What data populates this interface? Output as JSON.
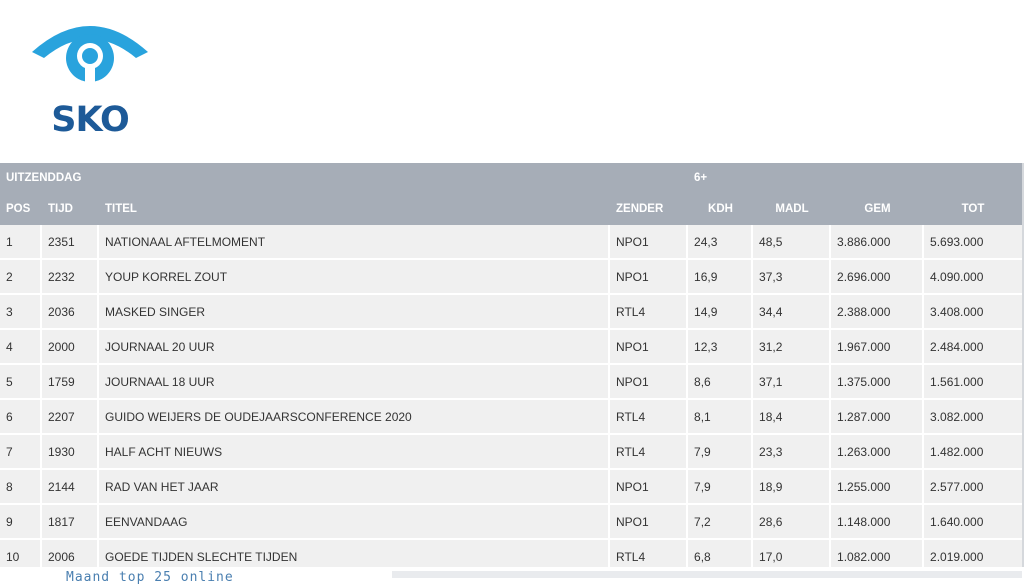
{
  "brand": {
    "name": "SKO",
    "color": "#1d5a98",
    "accent": "#29a3dd"
  },
  "table": {
    "group_labels": {
      "broadcast_day": "UITZENDDAG",
      "audience": "6+"
    },
    "columns": {
      "pos": "POS",
      "tijd": "TIJD",
      "titel": "TITEL",
      "zender": "ZENDER",
      "kdh": "KDH",
      "madl": "MADL",
      "gem": "GEM",
      "tot": "TOT"
    },
    "rows": [
      {
        "pos": "1",
        "tijd": "2351",
        "titel": "NATIONAAL AFTELMOMENT",
        "zender": "NPO1",
        "kdh": "24,3",
        "madl": "48,5",
        "gem": "3.886.000",
        "tot": "5.693.000"
      },
      {
        "pos": "2",
        "tijd": "2232",
        "titel": "YOUP KORREL ZOUT",
        "zender": "NPO1",
        "kdh": "16,9",
        "madl": "37,3",
        "gem": "2.696.000",
        "tot": "4.090.000"
      },
      {
        "pos": "3",
        "tijd": "2036",
        "titel": "MASKED SINGER",
        "zender": "RTL4",
        "kdh": "14,9",
        "madl": "34,4",
        "gem": "2.388.000",
        "tot": "3.408.000"
      },
      {
        "pos": "4",
        "tijd": "2000",
        "titel": "JOURNAAL 20 UUR",
        "zender": "NPO1",
        "kdh": "12,3",
        "madl": "31,2",
        "gem": "1.967.000",
        "tot": "2.484.000"
      },
      {
        "pos": "5",
        "tijd": "1759",
        "titel": "JOURNAAL 18 UUR",
        "zender": "NPO1",
        "kdh": "8,6",
        "madl": "37,1",
        "gem": "1.375.000",
        "tot": "1.561.000"
      },
      {
        "pos": "6",
        "tijd": "2207",
        "titel": "GUIDO WEIJERS DE OUDEJAARSCONFERENCE 2020",
        "zender": "RTL4",
        "kdh": "8,1",
        "madl": "18,4",
        "gem": "1.287.000",
        "tot": "3.082.000"
      },
      {
        "pos": "7",
        "tijd": "1930",
        "titel": "HALF ACHT NIEUWS",
        "zender": "RTL4",
        "kdh": "7,9",
        "madl": "23,3",
        "gem": "1.263.000",
        "tot": "1.482.000"
      },
      {
        "pos": "8",
        "tijd": "2144",
        "titel": "RAD VAN HET JAAR",
        "zender": "NPO1",
        "kdh": "7,9",
        "madl": "18,9",
        "gem": "1.255.000",
        "tot": "2.577.000"
      },
      {
        "pos": "9",
        "tijd": "1817",
        "titel": "EENVANDAAG",
        "zender": "NPO1",
        "kdh": "7,2",
        "madl": "28,6",
        "gem": "1.148.000",
        "tot": "1.640.000"
      },
      {
        "pos": "10",
        "tijd": "2006",
        "titel": "GOEDE TIJDEN SLECHTE TIJDEN",
        "zender": "RTL4",
        "kdh": "6,8",
        "madl": "17,0",
        "gem": "1.082.000",
        "tot": "2.019.000"
      }
    ]
  },
  "footer": {
    "link_text": "Maand top 25 online"
  }
}
